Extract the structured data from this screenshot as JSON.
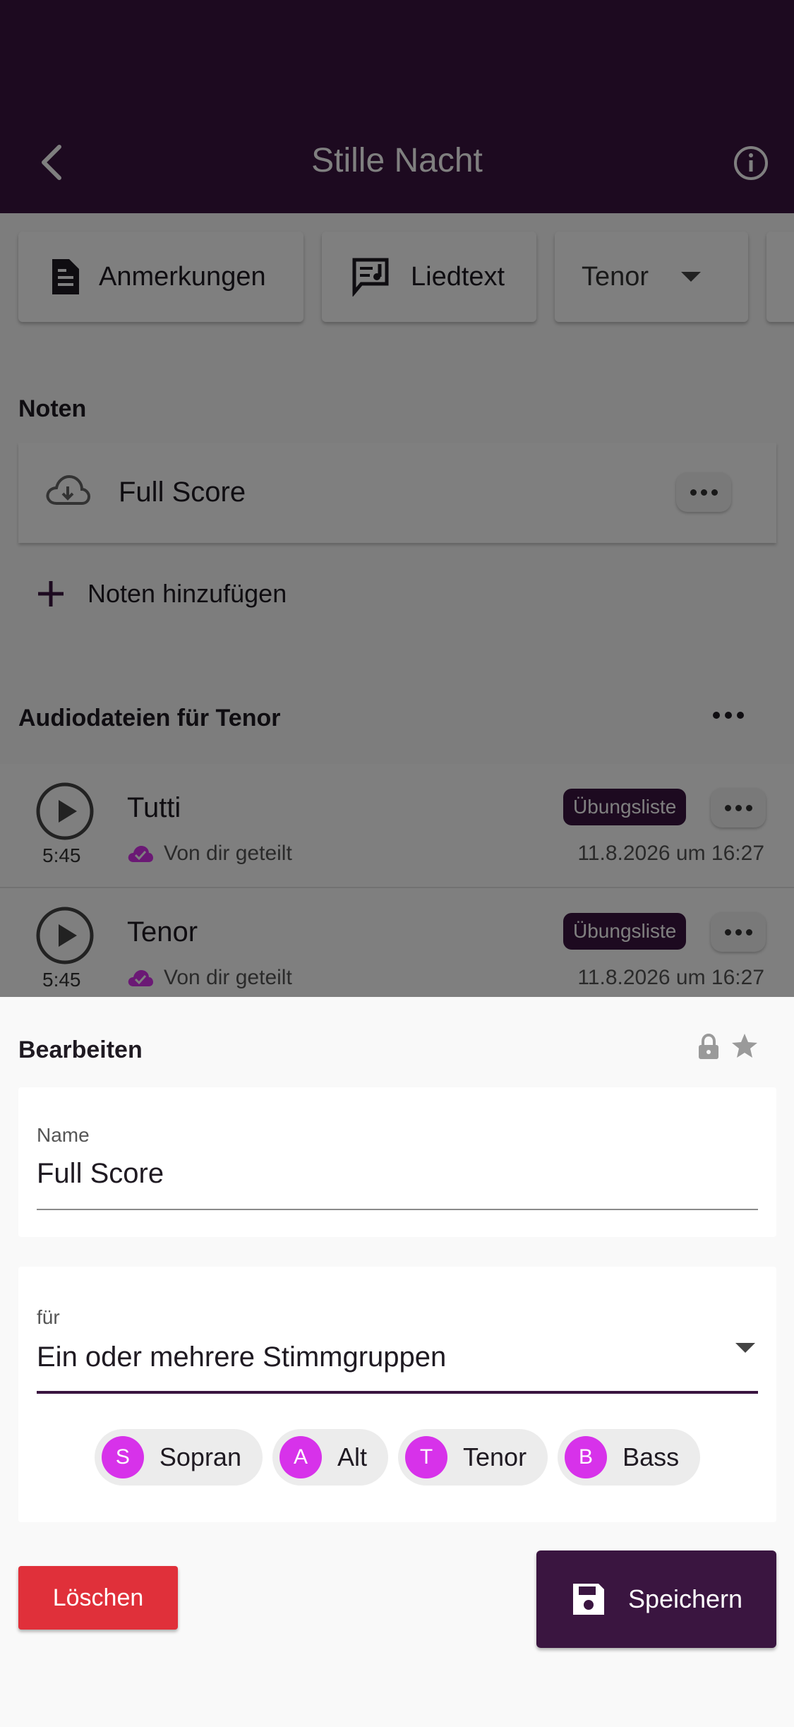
{
  "header": {
    "title": "Stille Nacht",
    "back_icon": "back-chevron-icon",
    "info_icon": "info-icon"
  },
  "toolbar": {
    "notes_label": "Anmerkungen",
    "lyrics_label": "Liedtext",
    "voice_select": "Tenor"
  },
  "scores": {
    "heading": "Noten",
    "items": [
      {
        "name": "Full Score"
      }
    ],
    "add_label": "Noten hinzufügen"
  },
  "audio": {
    "heading": "Audiodateien für Tenor",
    "items": [
      {
        "name": "Tutti",
        "duration": "5:45",
        "shared": "Von dir geteilt",
        "badge": "Übungsliste",
        "date": "11.8.2026 um 16:27"
      },
      {
        "name": "Tenor",
        "duration": "5:45",
        "shared": "Von dir geteilt",
        "badge": "Übungsliste",
        "date": "11.8.2026 um 16:27"
      }
    ]
  },
  "sheet": {
    "title": "Bearbeiten",
    "name_label": "Name",
    "name_value": "Full Score",
    "for_label": "für",
    "for_value": "Ein oder mehrere Stimmgruppen",
    "voices": [
      {
        "initial": "S",
        "label": "Sopran"
      },
      {
        "initial": "A",
        "label": "Alt"
      },
      {
        "initial": "T",
        "label": "Tenor"
      },
      {
        "initial": "B",
        "label": "Bass"
      }
    ],
    "delete_label": "Löschen",
    "save_label": "Speichern"
  },
  "colors": {
    "primary": "#3a1540",
    "accent": "#d732ea",
    "danger": "#e0303a"
  }
}
